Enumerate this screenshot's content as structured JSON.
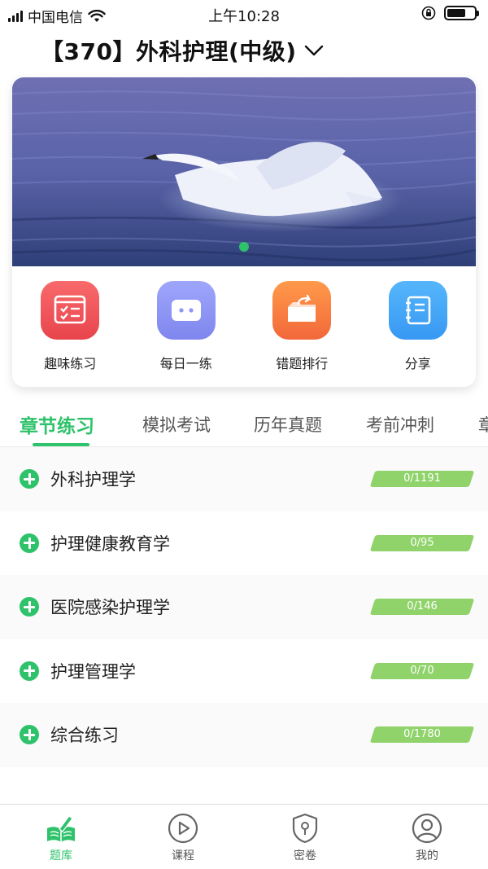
{
  "status_bar": {
    "carrier": "中国电信",
    "time": "上午10:28"
  },
  "header": {
    "title": "【370】外科护理(中级)"
  },
  "quick_actions": [
    {
      "label": "趣味练习",
      "icon": "fun-practice-icon",
      "color": "#f0525a"
    },
    {
      "label": "每日一练",
      "icon": "daily-practice-icon",
      "color": "#8e96f6"
    },
    {
      "label": "错题排行",
      "icon": "wrong-ranking-icon",
      "color": "#f97f3b"
    },
    {
      "label": "分享",
      "icon": "share-icon",
      "color": "#3fa6f6"
    }
  ],
  "tabs": [
    {
      "label": "章节练习",
      "active": true
    },
    {
      "label": "模拟考试",
      "active": false
    },
    {
      "label": "历年真题",
      "active": false
    },
    {
      "label": "考前冲刺",
      "active": false
    },
    {
      "label": "章",
      "active": false
    }
  ],
  "chapters": [
    {
      "name": "外科护理学",
      "progress": "0/1191"
    },
    {
      "name": "护理健康教育学",
      "progress": "0/95"
    },
    {
      "name": "医院感染护理学",
      "progress": "0/146"
    },
    {
      "name": "护理管理学",
      "progress": "0/70"
    },
    {
      "name": "综合练习",
      "progress": "0/1780"
    }
  ],
  "bottom_nav": [
    {
      "label": "题库",
      "icon": "question-bank-icon",
      "active": true
    },
    {
      "label": "课程",
      "icon": "course-play-icon",
      "active": false
    },
    {
      "label": "密卷",
      "icon": "secret-paper-icon",
      "active": false
    },
    {
      "label": "我的",
      "icon": "profile-icon",
      "active": false
    }
  ],
  "colors": {
    "accent": "#2ec26a",
    "progress_fill": "#8fd36a"
  }
}
